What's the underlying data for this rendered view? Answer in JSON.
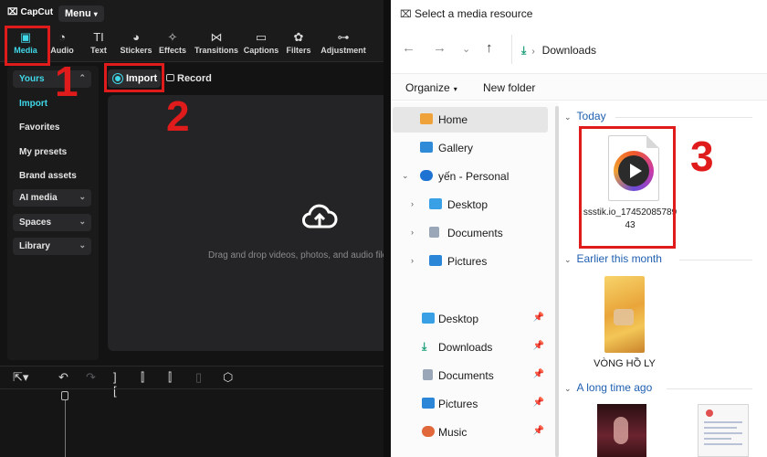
{
  "capcut": {
    "logo": "CapCut",
    "menu_label": "Menu",
    "toolbar": [
      {
        "label": "Media",
        "icon": "media-icon",
        "active": true
      },
      {
        "label": "Audio",
        "icon": "audio-icon"
      },
      {
        "label": "Text",
        "icon": "text-icon"
      },
      {
        "label": "Stickers",
        "icon": "stickers-icon"
      },
      {
        "label": "Effects",
        "icon": "effects-icon"
      },
      {
        "label": "Transitions",
        "icon": "transitions-icon"
      },
      {
        "label": "Captions",
        "icon": "captions-icon"
      },
      {
        "label": "Filters",
        "icon": "filters-icon"
      },
      {
        "label": "Adjustment",
        "icon": "adjustment-icon"
      }
    ],
    "sidebar": {
      "yours": "Yours",
      "import": "Import",
      "favorites": "Favorites",
      "my_presets": "My presets",
      "brand_assets": "Brand assets",
      "ai_media": "AI media",
      "spaces": "Spaces",
      "library": "Library"
    },
    "import_label": "Import",
    "record_label": "Record",
    "drop_text": "Drag and drop videos, photos, and audio files here",
    "accent_color": "#3fd8e8"
  },
  "annotations": [
    "1",
    "2",
    "3"
  ],
  "dialog": {
    "title": "Select a media resource",
    "address": "Downloads",
    "organize_label": "Organize",
    "new_folder_label": "New folder",
    "nav": {
      "home": "Home",
      "gallery": "Gallery",
      "personal": "yến - Personal",
      "desktop": "Desktop",
      "documents": "Documents",
      "pictures": "Pictures",
      "q_desktop": "Desktop",
      "q_downloads": "Downloads",
      "q_documents": "Documents",
      "q_pictures": "Pictures",
      "q_music": "Music"
    },
    "groups": {
      "today": "Today",
      "earlier": "Earlier this month",
      "long_ago": "A long time ago"
    },
    "files": {
      "video_name": "ssstik.io_1745208578943",
      "vong_name": "VÒNG HỒ LY"
    }
  }
}
